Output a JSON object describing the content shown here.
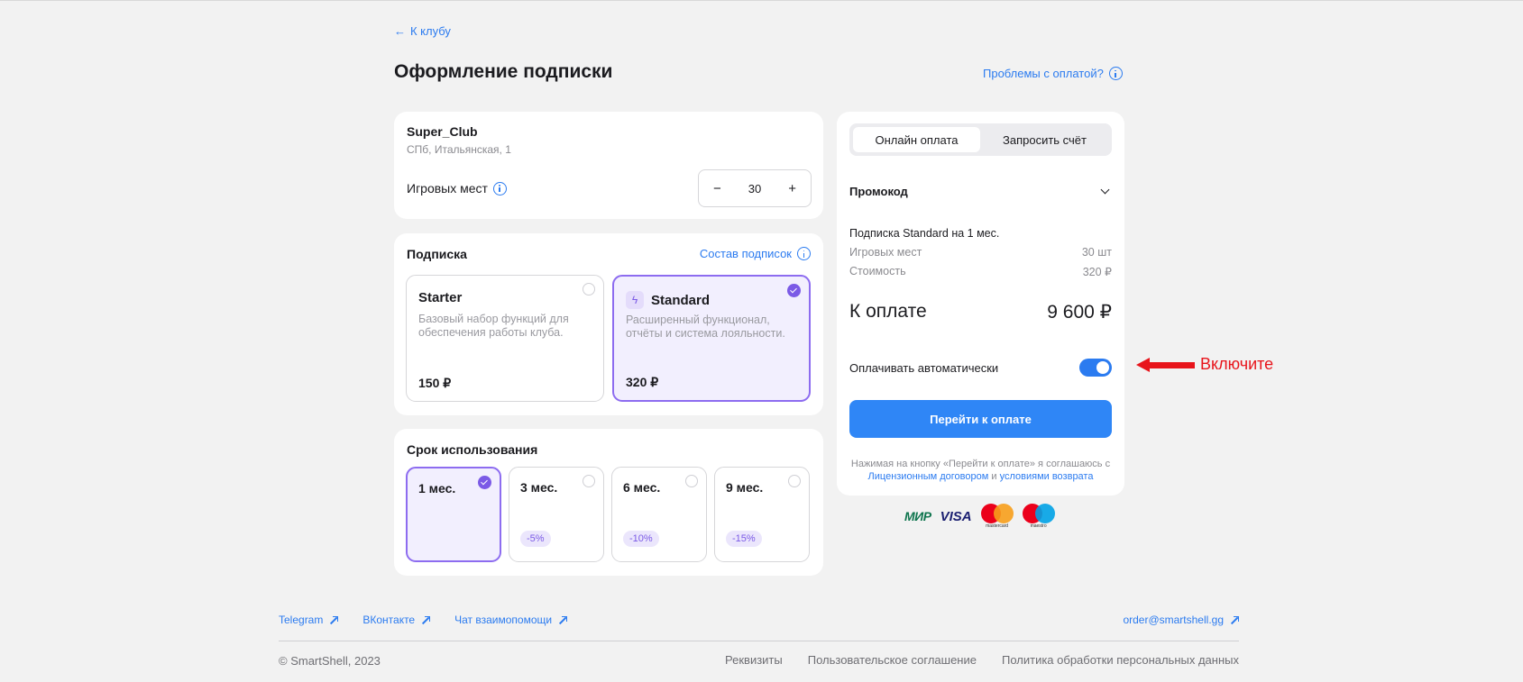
{
  "back_link": "К клубу",
  "page_title": "Оформление подписки",
  "help_link": "Проблемы с оплатой?",
  "club": {
    "name": "Super_Club",
    "address": "СПб, Итальянская, 1",
    "seats_label": "Игровых мест",
    "seats_value": "30",
    "minus": "−",
    "plus": "+"
  },
  "subscription": {
    "title": "Подписка",
    "composition_link": "Состав подписок",
    "plans": [
      {
        "name": "Starter",
        "description": "Базовый набор функций для обеспечения работы клуба.",
        "price": "150 ₽",
        "selected": false
      },
      {
        "name": "Standard",
        "description": "Расширенный функционал, отчёты и система лояльности.",
        "price": "320 ₽",
        "selected": true
      }
    ]
  },
  "term": {
    "title": "Срок использования",
    "options": [
      {
        "label": "1 мес.",
        "discount": "",
        "selected": true
      },
      {
        "label": "3 мес.",
        "discount": "-5%",
        "selected": false
      },
      {
        "label": "6 мес.",
        "discount": "-10%",
        "selected": false
      },
      {
        "label": "9 мес.",
        "discount": "-15%",
        "selected": false
      }
    ]
  },
  "payment": {
    "tabs": [
      "Онлайн оплата",
      "Запросить счёт"
    ],
    "active_tab": "Онлайн оплата",
    "promo_label": "Промокод",
    "summary_title": "Подписка Standard на 1 мес.",
    "rows": [
      {
        "label": "Игровых мест",
        "value": "30 шт"
      },
      {
        "label": "Стоимость",
        "value": "320 ₽"
      }
    ],
    "total_label": "К оплате",
    "total_value": "9 600 ₽",
    "auto_pay_label": "Оплачивать автоматически",
    "auto_pay_on": true,
    "pay_button": "Перейти к оплате",
    "legal_text_1": "Нажимая на кнопку «Перейти к оплате» я соглашаюсь с",
    "legal_link_1": "Лицензионным договором",
    "legal_and": "и",
    "legal_link_2": "условиями возврата"
  },
  "payment_logos": {
    "mir": "МИР",
    "visa": "VISA",
    "mastercard": "mastercard",
    "maestro": "maestro"
  },
  "annotation": {
    "text": "Включите",
    "color": "#e8141b"
  },
  "footer": {
    "links": [
      "Telegram",
      "ВКонтакте",
      "Чат взаимопомощи"
    ],
    "email": "order@smartshell.gg",
    "copyright": "© SmartShell, 2023",
    "legal_links": [
      "Реквизиты",
      "Пользовательское соглашение",
      "Политика обработки персональных данных"
    ]
  },
  "colors": {
    "accent": "#2b7bf0",
    "selected": "#8d6cf0",
    "background": "#f2f2f2"
  }
}
